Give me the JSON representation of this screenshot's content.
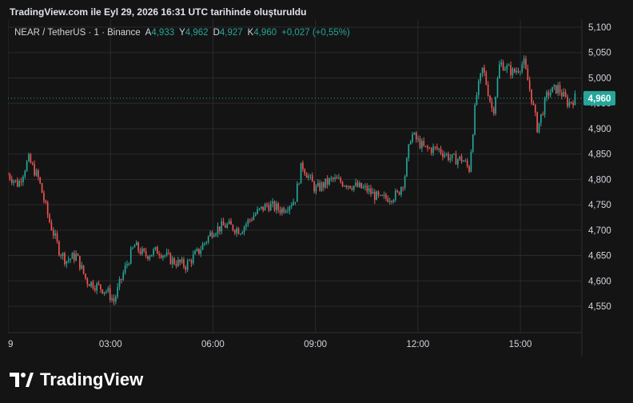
{
  "header": {
    "title": "TradingView.com ile Eyl 29, 2026 16:31 UTC tarihinde oluşturuldu"
  },
  "legend": {
    "symbol": "NEAR / TetherUS · 1 · Binance",
    "open_label": "A",
    "open": "4,933",
    "high_label": "Y",
    "high": "4,962",
    "low_label": "D",
    "low": "4,927",
    "close_label": "K",
    "close": "4,960",
    "change": "+0,027 (+0,55%)"
  },
  "brand": {
    "name": "TradingView"
  },
  "colors": {
    "background": "#141414",
    "up": "#26a69a",
    "down": "#ef5350",
    "grid": "#2a2a2a",
    "price_tag": "#26a69a"
  },
  "chart_data": {
    "type": "candlestick",
    "ylim": [
      4.52,
      5.1
    ],
    "y_ticks": [
      "5,100",
      "5,050",
      "5,000",
      "4,950",
      "4,900",
      "4,850",
      "4,800",
      "4,750",
      "4,700",
      "4,650",
      "4,600",
      "4,550"
    ],
    "y_tick_values": [
      5.1,
      5.05,
      5.0,
      4.95,
      4.9,
      4.85,
      4.8,
      4.75,
      4.7,
      4.65,
      4.6,
      4.55
    ],
    "x_ticks": [
      "9",
      "03:00",
      "06:00",
      "09:00",
      "12:00",
      "15:00"
    ],
    "x_tick_hours": [
      0,
      3,
      6,
      9,
      12,
      15
    ],
    "x_range_hours": [
      0,
      16.8
    ],
    "last_price": "4,960",
    "last_price_value": 4.96,
    "anchors": [
      [
        0.0,
        4.81
      ],
      [
        0.3,
        4.79
      ],
      [
        0.6,
        4.84
      ],
      [
        0.9,
        4.8
      ],
      [
        1.2,
        4.72
      ],
      [
        1.5,
        4.66
      ],
      [
        1.7,
        4.64
      ],
      [
        2.0,
        4.65
      ],
      [
        2.3,
        4.6
      ],
      [
        2.6,
        4.59
      ],
      [
        2.9,
        4.58
      ],
      [
        3.1,
        4.56
      ],
      [
        3.4,
        4.62
      ],
      [
        3.7,
        4.67
      ],
      [
        4.0,
        4.65
      ],
      [
        4.4,
        4.66
      ],
      [
        4.8,
        4.64
      ],
      [
        5.2,
        4.63
      ],
      [
        5.6,
        4.66
      ],
      [
        6.0,
        4.7
      ],
      [
        6.4,
        4.71
      ],
      [
        6.8,
        4.7
      ],
      [
        7.2,
        4.73
      ],
      [
        7.6,
        4.75
      ],
      [
        8.0,
        4.74
      ],
      [
        8.4,
        4.76
      ],
      [
        8.6,
        4.83
      ],
      [
        9.0,
        4.78
      ],
      [
        9.5,
        4.8
      ],
      [
        10.0,
        4.79
      ],
      [
        10.5,
        4.78
      ],
      [
        10.9,
        4.76
      ],
      [
        11.4,
        4.77
      ],
      [
        11.6,
        4.8
      ],
      [
        11.8,
        4.89
      ],
      [
        12.2,
        4.86
      ],
      [
        12.6,
        4.86
      ],
      [
        13.0,
        4.84
      ],
      [
        13.3,
        4.84
      ],
      [
        13.5,
        4.82
      ],
      [
        13.7,
        4.96
      ],
      [
        13.9,
        5.02
      ],
      [
        14.2,
        4.93
      ],
      [
        14.4,
        5.03
      ],
      [
        14.8,
        5.01
      ],
      [
        15.1,
        5.03
      ],
      [
        15.3,
        4.97
      ],
      [
        15.5,
        4.9
      ],
      [
        15.8,
        4.97
      ],
      [
        16.1,
        4.98
      ],
      [
        16.4,
        4.95
      ],
      [
        16.6,
        4.96
      ]
    ]
  }
}
